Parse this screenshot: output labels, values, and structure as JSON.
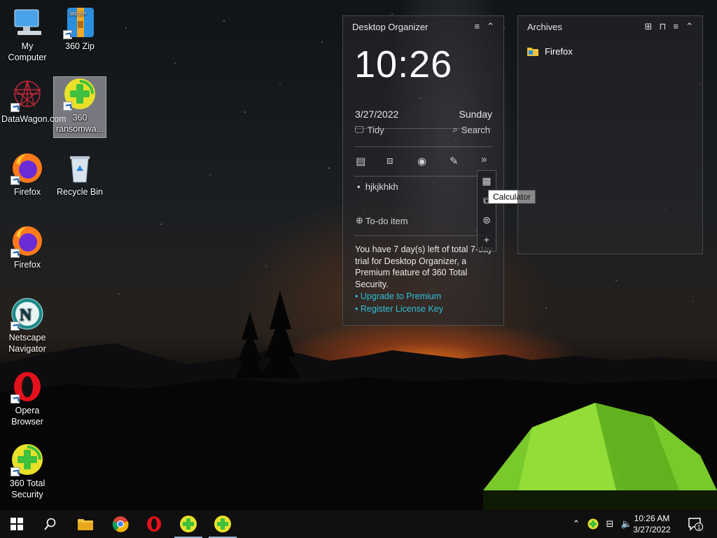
{
  "desktop_icons": [
    {
      "label": "My Computer",
      "icon": "computer-icon"
    },
    {
      "label": "360 Zip",
      "icon": "zip-icon",
      "badge": "360 ZIP"
    },
    {
      "label": "DataWagon.com",
      "icon": "datawagon-icon"
    },
    {
      "label": "360 ransomwa...",
      "icon": "360-plus-icon"
    },
    {
      "label": "Firefox",
      "icon": "firefox-icon"
    },
    {
      "label": "Recycle Bin",
      "icon": "recycle-bin-icon"
    },
    {
      "label": "Firefox",
      "icon": "firefox-icon"
    },
    {
      "label": "Netscape Navigator",
      "icon": "netscape-icon",
      "glyph": "N"
    },
    {
      "label": "Opera Browser",
      "icon": "opera-icon"
    },
    {
      "label": "360 Total Security",
      "icon": "360-plus-icon"
    }
  ],
  "organizer": {
    "title": "Desktop Organizer",
    "time": "10:26",
    "date": "3/27/2022",
    "day": "Sunday",
    "tidy_label": "Tidy",
    "search_label": "Search",
    "todo_items": [
      "hjkjkhkh"
    ],
    "add_todo_label": "To-do item",
    "trial_text": "You have 7 day(s) left of total 7-day trial for Desktop Organizer, a Premium feature of 360 Total Security.",
    "upgrade_link": "• Upgrade to Premium",
    "register_link": "• Register License Key",
    "tooltip": "Calculator"
  },
  "archives": {
    "title": "Archives",
    "items": [
      {
        "label": "Firefox",
        "icon": "folder-icon"
      }
    ]
  },
  "taskbar": {
    "time": "10:26 AM",
    "date": "3/27/2022",
    "notification_count": "1"
  },
  "colors": {
    "link": "#2fbfd8",
    "plus_green": "#3ec13e",
    "plus_yellow": "#e9e02a",
    "tent_green": "#7ad12a"
  }
}
